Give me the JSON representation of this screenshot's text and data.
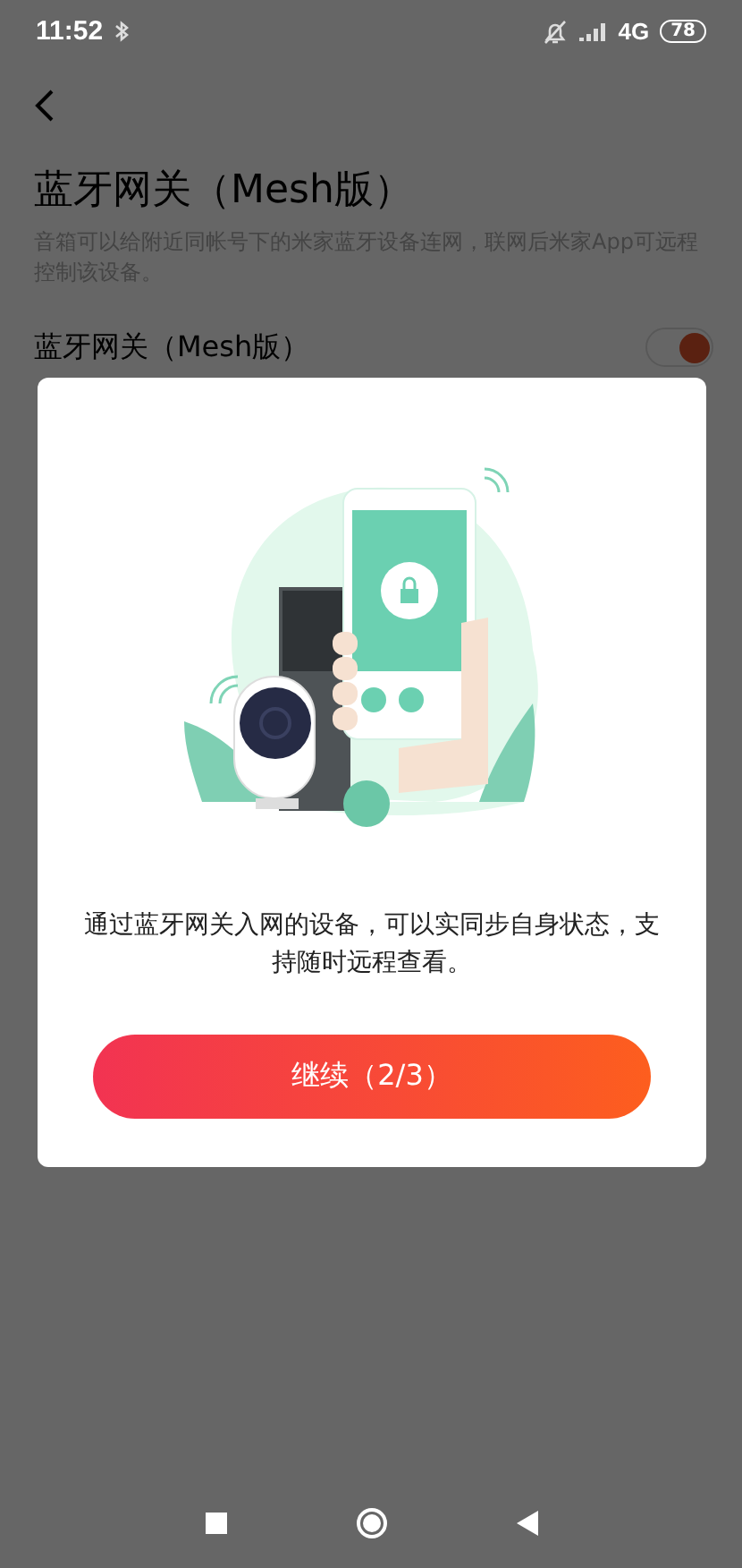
{
  "status_bar": {
    "time": "11:52",
    "network": "4G",
    "battery": "78"
  },
  "header": {
    "title": "蓝牙网关（Mesh版）",
    "description": "音箱可以给附近同帐号下的米家蓝牙设备连网，联网后米家App可远程控制该设备。"
  },
  "settings": [
    {
      "label": "蓝牙网关（Mesh版）",
      "on": true
    }
  ],
  "dialog": {
    "message": "通过蓝牙网关入网的设备，可以实同步自身状态，支持随时远程查看。",
    "button": "继续（2/3）"
  }
}
